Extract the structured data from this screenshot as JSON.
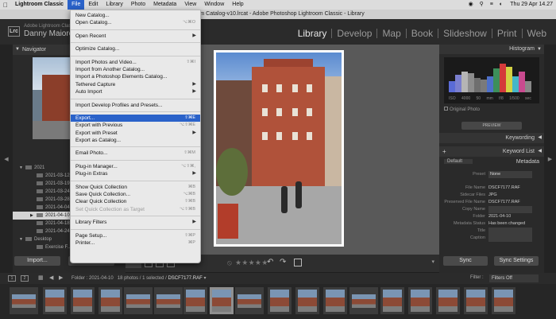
{
  "menubar": {
    "app": "Lightroom Classic",
    "items": [
      "File",
      "Edit",
      "Library",
      "Photo",
      "Metadata",
      "View",
      "Window",
      "Help"
    ],
    "clock": "Thu 29 Apr 14.27"
  },
  "window": {
    "title": "room Catalog-v10.lrcat - Adobe Photoshop Lightroom Classic - Library"
  },
  "identity": {
    "adobe": "Adobe Lightroom Classic",
    "user": "Danny Maiorca"
  },
  "modules": [
    "Library",
    "Develop",
    "Map",
    "Book",
    "Slideshow",
    "Print",
    "Web"
  ],
  "file_menu": [
    [
      {
        "label": "New Catalog...",
        "shortcut": "",
        "sub": false,
        "disabled": false
      },
      {
        "label": "Open Catalog...",
        "shortcut": "⌥⌘O",
        "sub": false,
        "disabled": false
      }
    ],
    [
      {
        "label": "Open Recent",
        "shortcut": "",
        "sub": true,
        "disabled": false
      }
    ],
    [
      {
        "label": "Optimize Catalog...",
        "shortcut": "",
        "sub": false,
        "disabled": false
      }
    ],
    [
      {
        "label": "Import Photos and Video...",
        "shortcut": "⇧⌘I",
        "sub": false,
        "disabled": false
      },
      {
        "label": "Import from Another Catalog...",
        "shortcut": "",
        "sub": false,
        "disabled": false
      },
      {
        "label": "Import a Photoshop Elements Catalog...",
        "shortcut": "",
        "sub": false,
        "disabled": false
      },
      {
        "label": "Tethered Capture",
        "shortcut": "",
        "sub": true,
        "disabled": false
      },
      {
        "label": "Auto Import",
        "shortcut": "",
        "sub": true,
        "disabled": false
      }
    ],
    [
      {
        "label": "Import Develop Profiles and Presets...",
        "shortcut": "",
        "sub": false,
        "disabled": false
      }
    ],
    [
      {
        "label": "Export...",
        "shortcut": "⇧⌘E",
        "sub": false,
        "disabled": false,
        "highlight": true
      },
      {
        "label": "Export with Previous",
        "shortcut": "⌥⇧⌘E",
        "sub": false,
        "disabled": false
      },
      {
        "label": "Export with Preset",
        "shortcut": "",
        "sub": true,
        "disabled": false
      },
      {
        "label": "Export as Catalog...",
        "shortcut": "",
        "sub": false,
        "disabled": false
      }
    ],
    [
      {
        "label": "Email Photo...",
        "shortcut": "⇧⌘M",
        "sub": false,
        "disabled": false
      }
    ],
    [
      {
        "label": "Plug-in Manager...",
        "shortcut": "⌥⇧⌘,",
        "sub": false,
        "disabled": false
      },
      {
        "label": "Plug-in Extras",
        "shortcut": "",
        "sub": true,
        "disabled": false
      }
    ],
    [
      {
        "label": "Show Quick Collection",
        "shortcut": "⌘B",
        "sub": false,
        "disabled": false
      },
      {
        "label": "Save Quick Collection...",
        "shortcut": "⌥⌘B",
        "sub": false,
        "disabled": false
      },
      {
        "label": "Clear Quick Collection",
        "shortcut": "⇧⌘B",
        "sub": false,
        "disabled": false
      },
      {
        "label": "Set Quick Collection as Target",
        "shortcut": "⌥⇧⌘B",
        "sub": false,
        "disabled": true
      }
    ],
    [
      {
        "label": "Library Filters",
        "shortcut": "",
        "sub": true,
        "disabled": false
      }
    ],
    [
      {
        "label": "Page Setup...",
        "shortcut": "⇧⌘P",
        "sub": false,
        "disabled": false
      },
      {
        "label": "Printer...",
        "shortcut": "⌘P",
        "sub": false,
        "disabled": false
      }
    ]
  ],
  "left_panel": {
    "navigator": "Navigator",
    "folders": [
      {
        "label": "2021",
        "level": 0,
        "selected": false,
        "open": true
      },
      {
        "label": "2021-03-12",
        "level": 1,
        "selected": false
      },
      {
        "label": "2021-03-19",
        "level": 1,
        "selected": false
      },
      {
        "label": "2021-03-24",
        "level": 1,
        "selected": false
      },
      {
        "label": "2021-03-28",
        "level": 1,
        "selected": false
      },
      {
        "label": "2021-04-04",
        "level": 1,
        "selected": false
      },
      {
        "label": "2021-04-10",
        "level": 1,
        "selected": true
      },
      {
        "label": "2021-04-18",
        "level": 1,
        "selected": false
      },
      {
        "label": "2021-04-24",
        "level": 1,
        "selected": false
      },
      {
        "label": "Desktop",
        "level": 0,
        "selected": false,
        "open": true
      },
      {
        "label": "Exercise F...",
        "level": 1,
        "selected": false
      }
    ],
    "import_btn": "Import...",
    "export_btn": "Export..."
  },
  "right_panel": {
    "histogram": "Histogram",
    "histo_info": "ISO 4000 50 mm f/8 1/500 sec",
    "original_photo": "Original Photo",
    "previous_btn": "PREVIEW",
    "keywording": "Keywording",
    "keyword_list": "Keyword List",
    "metadata": "Metadata",
    "meta_default": "Default",
    "preset_label": "Preset",
    "preset_value": "None",
    "fields": [
      {
        "k": "File Name",
        "v": "DSCF7177.RAF",
        "box": false
      },
      {
        "k": "Sidecar Files",
        "v": "JPG",
        "box": false
      },
      {
        "k": "Preserved File Name",
        "v": "DSCF7177.RAF",
        "box": false
      },
      {
        "k": "Copy Name",
        "v": "",
        "box": true
      },
      {
        "k": "Folder",
        "v": "2021-04-10",
        "box": false
      },
      {
        "k": "Metadata Status",
        "v": "Has been changed",
        "box": false
      },
      {
        "k": "Title",
        "v": "",
        "box": true
      },
      {
        "k": "Caption",
        "v": "",
        "box": true
      }
    ],
    "sync_btn": "Sync",
    "sync_settings_btn": "Sync Settings"
  },
  "filmstrip_bar": {
    "folder_label": "Folder :",
    "folder": "2021-04-10",
    "count": "18 photos / 1 selected /",
    "file": "DSCF7177.RAF",
    "filter_label": "Filter :",
    "filter_value": "Filters Off"
  },
  "colors": {
    "accent": "#2a62c9",
    "menu_bg": "#e9e9e9",
    "panel": "#2a2a2a",
    "canvas": "#595959"
  }
}
